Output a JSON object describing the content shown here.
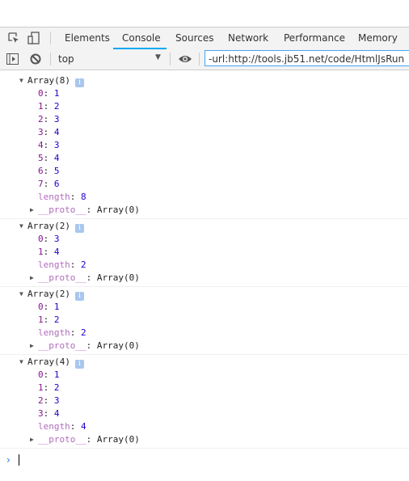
{
  "tabs": [
    "Elements",
    "Console",
    "Sources",
    "Network",
    "Performance",
    "Memory"
  ],
  "active_tab": "Console",
  "toolbar": {
    "context": "top",
    "filter_value": "-url:http://tools.jb51.net/code/HtmlJsRun"
  },
  "groups": [
    {
      "header": "Array(8)",
      "items": [
        [
          "0",
          "1"
        ],
        [
          "1",
          "2"
        ],
        [
          "2",
          "3"
        ],
        [
          "3",
          "4"
        ],
        [
          "4",
          "3"
        ],
        [
          "5",
          "4"
        ],
        [
          "6",
          "5"
        ],
        [
          "7",
          "6"
        ]
      ],
      "length": "8"
    },
    {
      "header": "Array(2)",
      "items": [
        [
          "0",
          "3"
        ],
        [
          "1",
          "4"
        ]
      ],
      "length": "2"
    },
    {
      "header": "Array(2)",
      "items": [
        [
          "0",
          "1"
        ],
        [
          "1",
          "2"
        ]
      ],
      "length": "2"
    },
    {
      "header": "Array(4)",
      "items": [
        [
          "0",
          "1"
        ],
        [
          "1",
          "2"
        ],
        [
          "2",
          "3"
        ],
        [
          "3",
          "4"
        ]
      ],
      "length": "4"
    }
  ],
  "labels": {
    "length": "length",
    "proto": "__proto__",
    "proto_value": "Array(0)",
    "info": "i",
    "prompt": "›"
  },
  "colors": {
    "accent": "#03a9f4",
    "key": "#881391",
    "value": "#1c00cf"
  }
}
